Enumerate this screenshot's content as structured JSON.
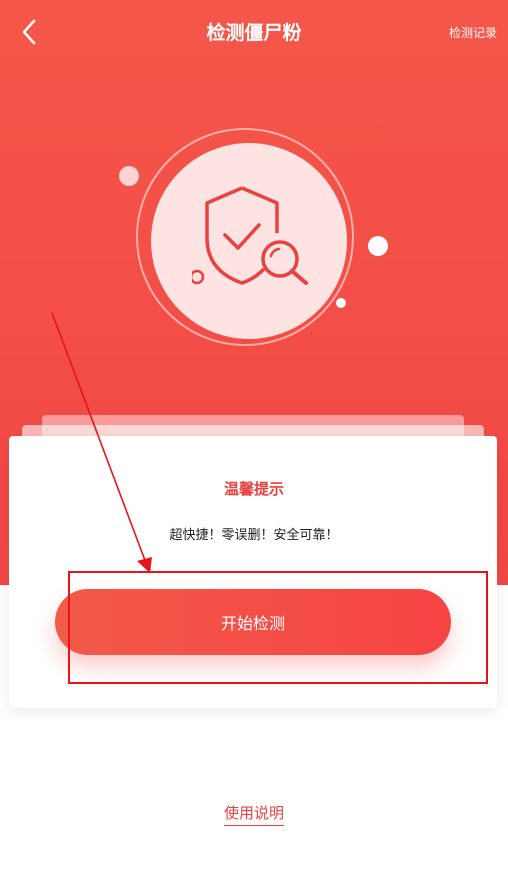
{
  "header": {
    "title": "检测僵尸粉",
    "record_link": "检测记录",
    "back_icon": "chevron-left-icon"
  },
  "hero": {
    "icon": "shield-search-icon",
    "bg_color": "#f24644"
  },
  "card": {
    "title": "温馨提示",
    "message": "超快捷！零误删！安全可靠！"
  },
  "actions": {
    "start_label": "开始检测"
  },
  "footer": {
    "help_link": "使用说明"
  },
  "colors": {
    "accent": "#ec4040",
    "annotation": "#e8141b"
  }
}
